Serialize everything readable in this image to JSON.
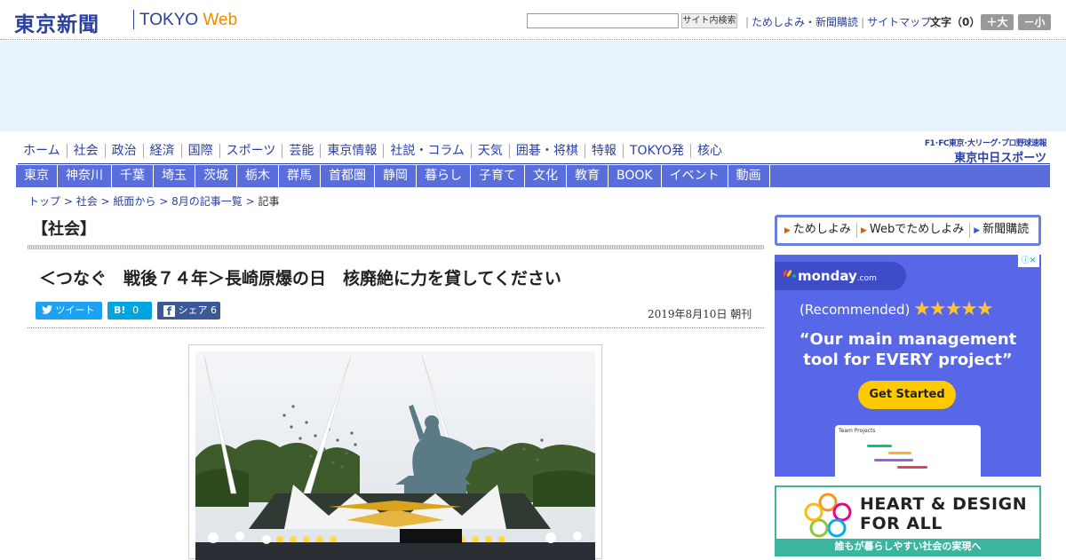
{
  "header": {
    "logo_main": "東京新聞",
    "logo_tokyo": "TOKYO",
    "logo_web": "Web",
    "search": {
      "placeholder": "",
      "button_label": "サイト内検索"
    },
    "links": [
      "ためしよみ・新聞購読",
      "サイトマップ"
    ],
    "font_size_label": "文字（0）",
    "font_larger": "＋大",
    "font_smaller": "－小"
  },
  "nav_primary": [
    "ホーム",
    "社会",
    "政治",
    "経済",
    "国際",
    "スポーツ",
    "芸能",
    "東京情報",
    "社説・コラム",
    "天気",
    "囲碁・将棋",
    "特報",
    "TOKYO発",
    "核心"
  ],
  "chunichi": {
    "line1": "F1･FC東京･大リーグ･プロ野球速報",
    "line2": "東京中日スポーツ"
  },
  "nav_regional": [
    "東京",
    "神奈川",
    "千葉",
    "埼玉",
    "茨城",
    "栃木",
    "群馬",
    "首都圏",
    "静岡",
    "暮らし",
    "子育て",
    "文化",
    "教育",
    "BOOK",
    "イベント",
    "動画"
  ],
  "breadcrumb": {
    "items": [
      "トップ",
      "社会",
      "紙面から",
      "8月の記事一覧"
    ],
    "current": "記事"
  },
  "article": {
    "section": "【社会】",
    "headline": "＜つなぐ　戦後７４年＞長崎原爆の日　核廃絶に力を貸してください",
    "date": "2019年8月10日 朝刊",
    "share": {
      "tweet": "ツイート",
      "hatena": "B!",
      "hatena_count": "0",
      "facebook": "シェア",
      "facebook_count": "6"
    }
  },
  "sidebar": {
    "menu": [
      "ためしよみ",
      "Webでためしよみ",
      "新聞購読"
    ],
    "ad_monday": {
      "brand": "monday",
      "brand_suffix": ".com",
      "recommended": "(Recommended)",
      "quote": "“Our main management tool for EVERY project”",
      "cta": "Get Started",
      "screenshot_title": "Team Projects"
    },
    "ad_heart": {
      "title_line1": "HEART & DESIGN",
      "title_line2": "FOR ALL",
      "subtitle": "誰もが暮らしやすい社会の実現へ"
    }
  },
  "colors": {
    "brand_blue": "#2a3fa0",
    "nav_bar": "#5a6edb",
    "twitter": "#1da1f2",
    "hatena": "#00a4de",
    "facebook": "#3b5998",
    "monday_bg": "#5867e8",
    "monday_cta": "#ffcb00",
    "heart_green": "#3bb59e"
  }
}
